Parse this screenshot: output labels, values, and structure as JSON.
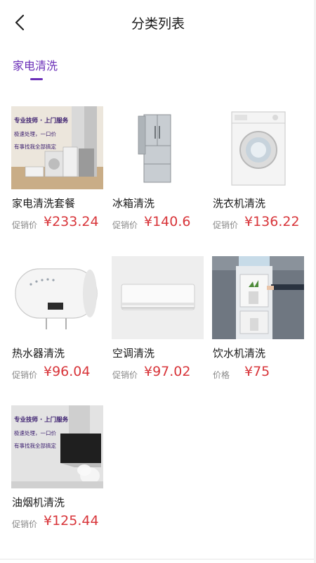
{
  "header": {
    "title": "分类列表",
    "back_icon": "chevron-left-icon"
  },
  "tabs": [
    {
      "label": "家电清洗",
      "active": true,
      "color": "#6b2fb8"
    }
  ],
  "banner_overlay": {
    "title": "专业技师 · 上门服务",
    "lines": [
      "极速处理，一口价",
      "有事找我全部搞定"
    ]
  },
  "products": [
    {
      "name": "家电清洗套餐",
      "price_label": "促销价",
      "price": "¥233.24"
    },
    {
      "name": "冰箱清洗",
      "price_label": "促销价",
      "price": "¥140.6"
    },
    {
      "name": "洗衣机清洗",
      "price_label": "促销价",
      "price": "¥136.22"
    },
    {
      "name": "热水器清洗",
      "price_label": "促销价",
      "price": "¥96.04"
    },
    {
      "name": "空调清洗",
      "price_label": "促销价",
      "price": "¥97.02"
    },
    {
      "name": "饮水机清洗",
      "price_label": "价格",
      "price": "¥75"
    },
    {
      "name": "油烟机清洗",
      "price_label": "促销价",
      "price": "¥125.44"
    }
  ],
  "colors": {
    "accent": "#6b2fb8",
    "price": "#d8353a"
  }
}
